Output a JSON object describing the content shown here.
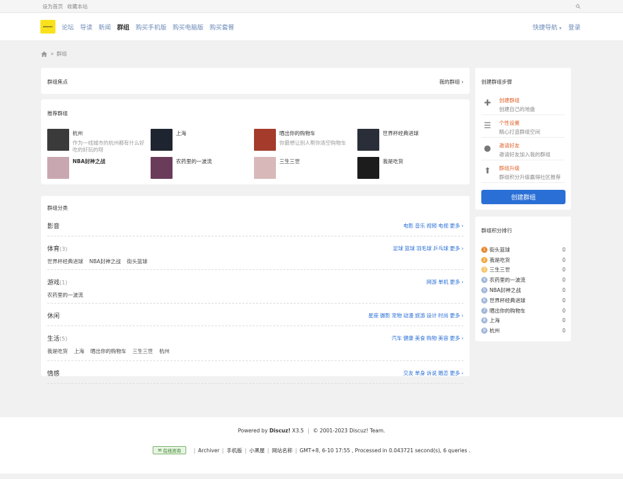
{
  "topbar": {
    "set_home": "设为首页",
    "bookmark": "收藏本站"
  },
  "header": {
    "logo_text": "DISCUZ!",
    "nav": [
      "论坛",
      "导读",
      "新闻",
      "群组",
      "购买手机版",
      "购买电脑版",
      "购买套餐"
    ],
    "active_nav": "群组",
    "quick_nav": "快捷导航",
    "login": "登录"
  },
  "breadcrumb": {
    "current": "群组"
  },
  "focus": {
    "title": "群组焦点",
    "my_group": "我的群组"
  },
  "recommend": {
    "title": "推荐群组",
    "groups": [
      {
        "name": "杭州",
        "desc": "作为一线城市的杭州都有什么好吃的好玩的呀",
        "color": "#3a3a3a"
      },
      {
        "name": "上海",
        "desc": "",
        "color": "#1f2530"
      },
      {
        "name": "晒出你的购物车",
        "desc": "你最想让别人帮你清空购物车",
        "color": "#a53b2a"
      },
      {
        "name": "世界杯经典进球",
        "desc": "",
        "color": "#2a2e38"
      },
      {
        "name": "NBA封神之战",
        "desc": "",
        "color": "#c9a7b0"
      },
      {
        "name": "农药里的一波流",
        "desc": "",
        "color": "#6a3c5a"
      },
      {
        "name": "三生三世",
        "desc": "",
        "color": "#d8b8b8"
      },
      {
        "name": "我是吃货",
        "desc": "",
        "color": "#1c1c1c"
      }
    ]
  },
  "category": {
    "title": "群组分类",
    "more": "更多",
    "rows": [
      {
        "name": "影音",
        "count": "",
        "links": [
          "电影",
          "音乐",
          "视频",
          "电视"
        ],
        "groups": []
      },
      {
        "name": "体育",
        "count": "(3)",
        "links": [
          "足球",
          "篮球",
          "羽毛球",
          "乒乓球"
        ],
        "groups": [
          "世界杯经典进球",
          "NBA封神之战",
          "街头篮球"
        ]
      },
      {
        "name": "游戏",
        "count": "(1)",
        "links": [
          "网游",
          "单机"
        ],
        "groups": [
          "农药里的一波流"
        ]
      },
      {
        "name": "休闲",
        "count": "",
        "links": [
          "星座",
          "摄影",
          "宠物",
          "动漫",
          "旅游",
          "设计",
          "时尚"
        ],
        "groups": []
      },
      {
        "name": "生活",
        "count": "(5)",
        "links": [
          "汽车",
          "健康",
          "美食",
          "购物",
          "美容"
        ],
        "groups": [
          "我是吃货",
          "上海",
          "晒出你的购物车",
          "三生三世",
          "杭州"
        ]
      },
      {
        "name": "情感",
        "count": "",
        "links": [
          "交友",
          "单身",
          "诉说",
          "婚恋"
        ],
        "groups": []
      }
    ]
  },
  "steps": {
    "title": "创建群组步骤",
    "items": [
      {
        "title": "创建群组",
        "desc": "创建自己的地盘",
        "icon": "plus-icon"
      },
      {
        "title": "个性设置",
        "desc": "精心打造群组空间",
        "icon": "list-icon"
      },
      {
        "title": "邀请好友",
        "desc": "邀请好友加入我的群组",
        "icon": "user-icon"
      },
      {
        "title": "群组升级",
        "desc": "群组积分升级赢得社区推荐",
        "icon": "upload-icon"
      }
    ],
    "create_button": "创建群组"
  },
  "rank": {
    "title": "群组积分排行",
    "items": [
      {
        "num": "1",
        "name": "街头篮球",
        "score": "0",
        "color": "#e8862a"
      },
      {
        "num": "2",
        "name": "我是吃货",
        "score": "0",
        "color": "#f0a640"
      },
      {
        "num": "3",
        "name": "三生三世",
        "score": "0",
        "color": "#f5c46a"
      },
      {
        "num": "4",
        "name": "农药里的一波流",
        "score": "0",
        "color": "#9fb6d8"
      },
      {
        "num": "5",
        "name": "NBA封神之战",
        "score": "0",
        "color": "#9fb6d8"
      },
      {
        "num": "6",
        "name": "世界杯经典进球",
        "score": "0",
        "color": "#9fb6d8"
      },
      {
        "num": "7",
        "name": "晒出你的购物车",
        "score": "0",
        "color": "#9fb6d8"
      },
      {
        "num": "8",
        "name": "上海",
        "score": "0",
        "color": "#9fb6d8"
      },
      {
        "num": "9",
        "name": "杭州",
        "score": "0",
        "color": "#9fb6d8"
      }
    ]
  },
  "footer": {
    "powered_prefix": "Powered by ",
    "powered_brand": "Discuz!",
    "powered_version": " X3.5",
    "copyright": "© 2001-2023 Discuz! Team.",
    "consult": "在线咨询",
    "links": [
      "Archiver",
      "手机版",
      "小黑屋",
      "网站名称"
    ],
    "stats": "GMT+8, 6-10 17:55 , Processed in 0.043721 second(s), 6 queries ."
  }
}
